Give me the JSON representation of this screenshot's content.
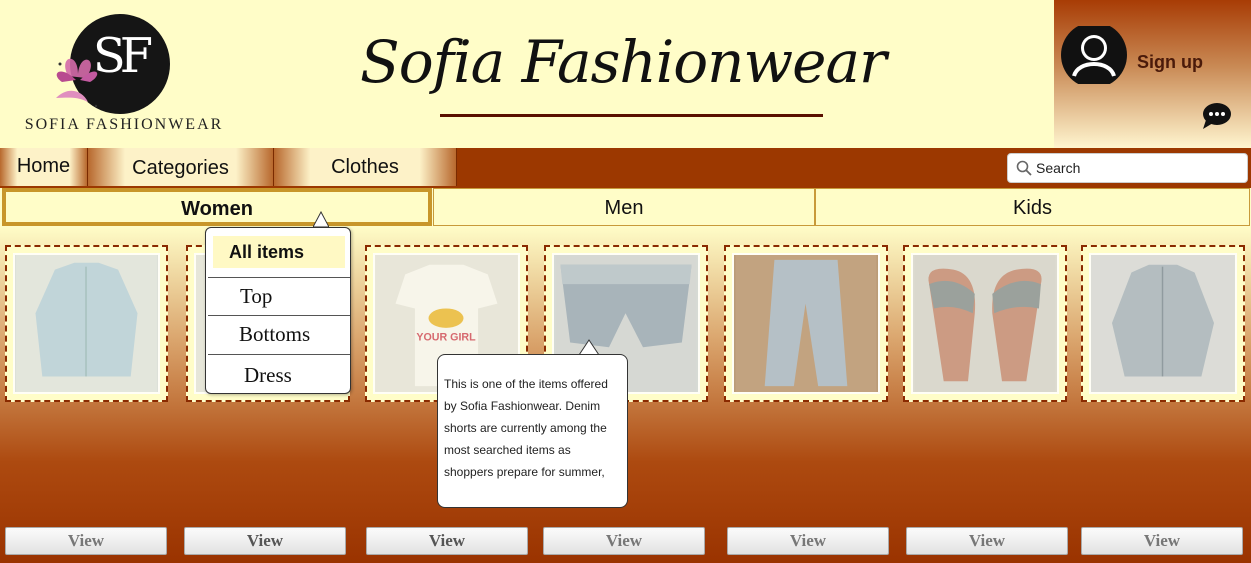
{
  "header": {
    "logo_monogram": "SF",
    "logo_text": "SOFIA FASHIONWEAR",
    "site_title": "Sofia Fashionwear",
    "signup_label": "Sign up"
  },
  "nav": {
    "home": "Home",
    "categories": "Categories",
    "clothes": "Clothes",
    "search_placeholder": "Search"
  },
  "tabs": {
    "women": "Women",
    "men": "Men",
    "kids": "Kids"
  },
  "dropdown": {
    "all_items": "All items",
    "top": "Top",
    "bottoms": "Bottoms",
    "dress": "Dress"
  },
  "products": [
    {
      "view_label": "View"
    },
    {
      "view_label": "View"
    },
    {
      "view_label": "View",
      "shirt_text": "YOUR GIRL"
    },
    {
      "view_label": "View"
    },
    {
      "view_label": "View"
    },
    {
      "view_label": "View"
    },
    {
      "view_label": "View"
    }
  ],
  "tooltip": {
    "text": "This is one of the items offered by Sofia Fashionwear. Denim shorts are currently among the most searched items as shoppers prepare for summer,"
  },
  "colors": {
    "header_bg": "#fffdc8",
    "nav_bg": "#9c3800",
    "accent": "#c8962a",
    "signup_text": "#4a1a0a"
  }
}
